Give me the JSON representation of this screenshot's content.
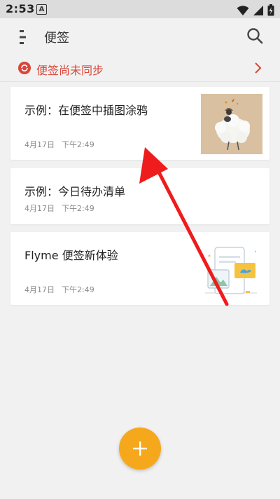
{
  "status_bar": {
    "time": "2:53",
    "notification_letter": "A"
  },
  "app_bar": {
    "title": "便签"
  },
  "sync_banner": {
    "text": "便签尚未同步"
  },
  "notes": [
    {
      "title": "示例：在便签中插图涂鸦",
      "date": "4月17日",
      "time": "下午2:49"
    },
    {
      "title": "示例：今日待办清单",
      "date": "4月17日",
      "time": "下午2:49"
    },
    {
      "title": "Flyme 便签新体验",
      "date": "4月17日",
      "time": "下午2:49"
    }
  ],
  "colors": {
    "accent": "#f6a81c",
    "sync_warning": "#d9473a",
    "annotation_arrow": "#ee1c1c"
  },
  "icons": [
    "menu-icon",
    "search-icon",
    "sync-icon",
    "chevron-right-icon",
    "add-icon",
    "wifi-icon",
    "signal-icon",
    "battery-icon"
  ]
}
